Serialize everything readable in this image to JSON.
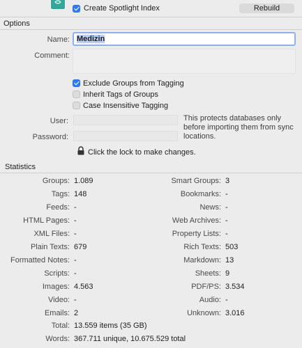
{
  "top": {
    "spotlight_label": "Create Spotlight Index",
    "spotlight_checked": true,
    "rebuild_label": "Rebuild"
  },
  "options": {
    "title": "Options",
    "name_label": "Name:",
    "name_value": "Medizin",
    "comment_label": "Comment:",
    "comment_value": "",
    "checkboxes": [
      {
        "label": "Exclude Groups from Tagging",
        "checked": true
      },
      {
        "label": "Inherit Tags of Groups",
        "checked": false
      },
      {
        "label": "Case Insensitive Tagging",
        "checked": false
      }
    ],
    "user_label": "User:",
    "password_label": "Password:",
    "sync_note": "This protects databases only before importing them from sync locations.",
    "lock_text": "Click the lock to make changes."
  },
  "statistics": {
    "title": "Statistics",
    "left": [
      {
        "label": "Groups:",
        "value": "1.089"
      },
      {
        "label": "Tags:",
        "value": "148"
      },
      {
        "label": "Feeds:",
        "value": "-"
      },
      {
        "label": "HTML Pages:",
        "value": "-"
      },
      {
        "label": "XML Files:",
        "value": "-"
      },
      {
        "label": "Plain Texts:",
        "value": "679"
      },
      {
        "label": "Formatted Notes:",
        "value": "-"
      },
      {
        "label": "Scripts:",
        "value": "-"
      },
      {
        "label": "Images:",
        "value": "4.563"
      },
      {
        "label": "Video:",
        "value": "-"
      },
      {
        "label": "Emails:",
        "value": "2"
      }
    ],
    "right": [
      {
        "label": "Smart Groups:",
        "value": "3"
      },
      {
        "label": "Bookmarks:",
        "value": "-"
      },
      {
        "label": "News:",
        "value": "-"
      },
      {
        "label": "Web Archives:",
        "value": "-"
      },
      {
        "label": "Property Lists:",
        "value": "-"
      },
      {
        "label": "Rich Texts:",
        "value": "503"
      },
      {
        "label": "Markdown:",
        "value": "13"
      },
      {
        "label": "Sheets:",
        "value": "9"
      },
      {
        "label": "PDF/PS:",
        "value": "3.534"
      },
      {
        "label": "Audio:",
        "value": "-"
      },
      {
        "label": "Unknown:",
        "value": "3.016"
      }
    ],
    "total_label": "Total:",
    "total_value": "13.559 items (35 GB)",
    "words_label": "Words:",
    "words_value": "367.711 unique, 10.675.529 total"
  }
}
